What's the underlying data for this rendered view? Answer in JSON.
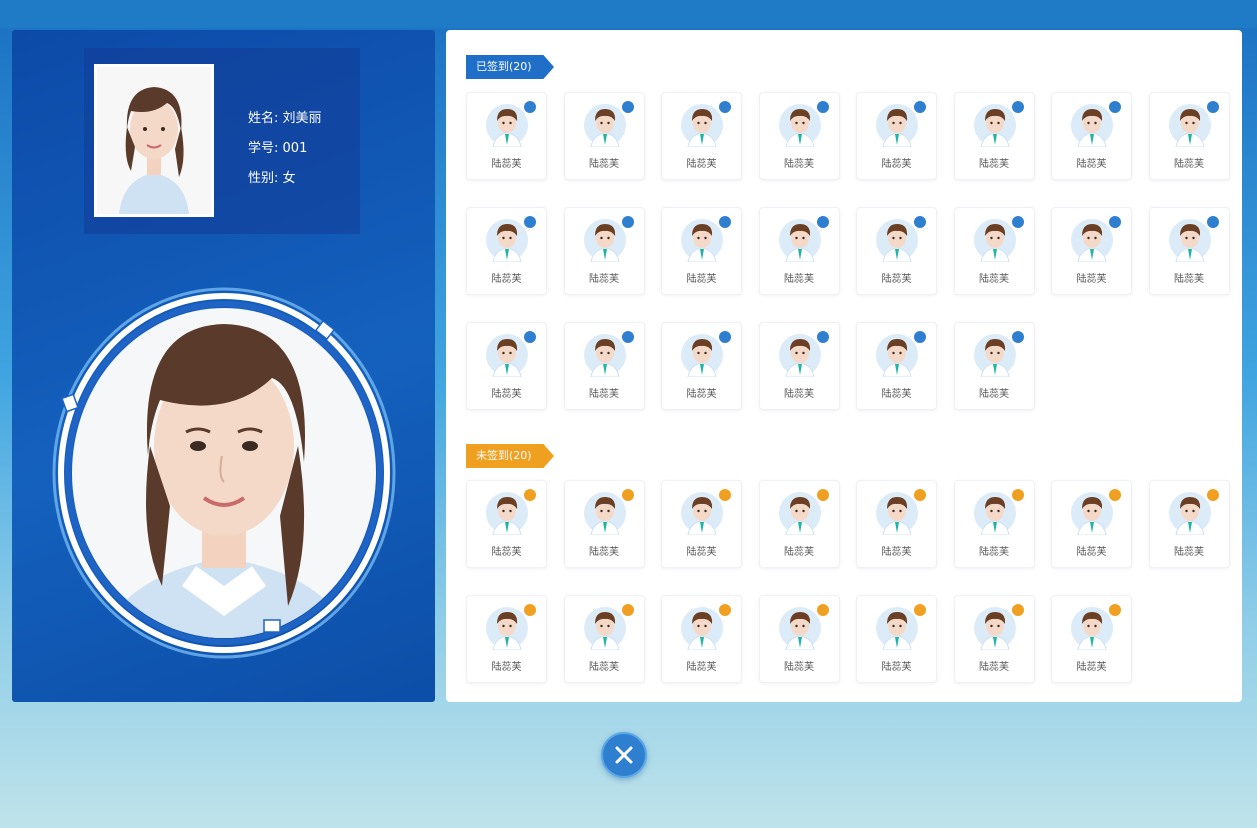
{
  "student": {
    "name_label": "姓名:",
    "name": "刘美丽",
    "id_label": "学号:",
    "id": "001",
    "gender_label": "性别:",
    "gender": "女"
  },
  "signed": {
    "tag": "已签到(20)",
    "dot_color": "#2f7fd0",
    "people": [
      "陆蕊芙",
      "陆蕊芙",
      "陆蕊芙",
      "陆蕊芙",
      "陆蕊芙",
      "陆蕊芙",
      "陆蕊芙",
      "陆蕊芙",
      "陆蕊芙",
      "陆蕊芙",
      "陆蕊芙",
      "陆蕊芙",
      "陆蕊芙",
      "陆蕊芙",
      "陆蕊芙",
      "陆蕊芙",
      "陆蕊芙",
      "陆蕊芙",
      "陆蕊芙",
      "陆蕊芙",
      "陆蕊芙",
      "陆蕊芙"
    ]
  },
  "unsigned": {
    "tag": "未签到(20)",
    "dot_color": "#f0a020",
    "people": [
      "陆蕊芙",
      "陆蕊芙",
      "陆蕊芙",
      "陆蕊芙",
      "陆蕊芙",
      "陆蕊芙",
      "陆蕊芙",
      "陆蕊芙",
      "陆蕊芙",
      "陆蕊芙",
      "陆蕊芙",
      "陆蕊芙",
      "陆蕊芙",
      "陆蕊芙",
      "陆蕊芙"
    ]
  },
  "close_button": {
    "icon": "close-icon"
  },
  "colors": {
    "primary": "#1f6fc8",
    "accent_orange": "#f0a020",
    "panel_blue": "#0d4aa8"
  }
}
